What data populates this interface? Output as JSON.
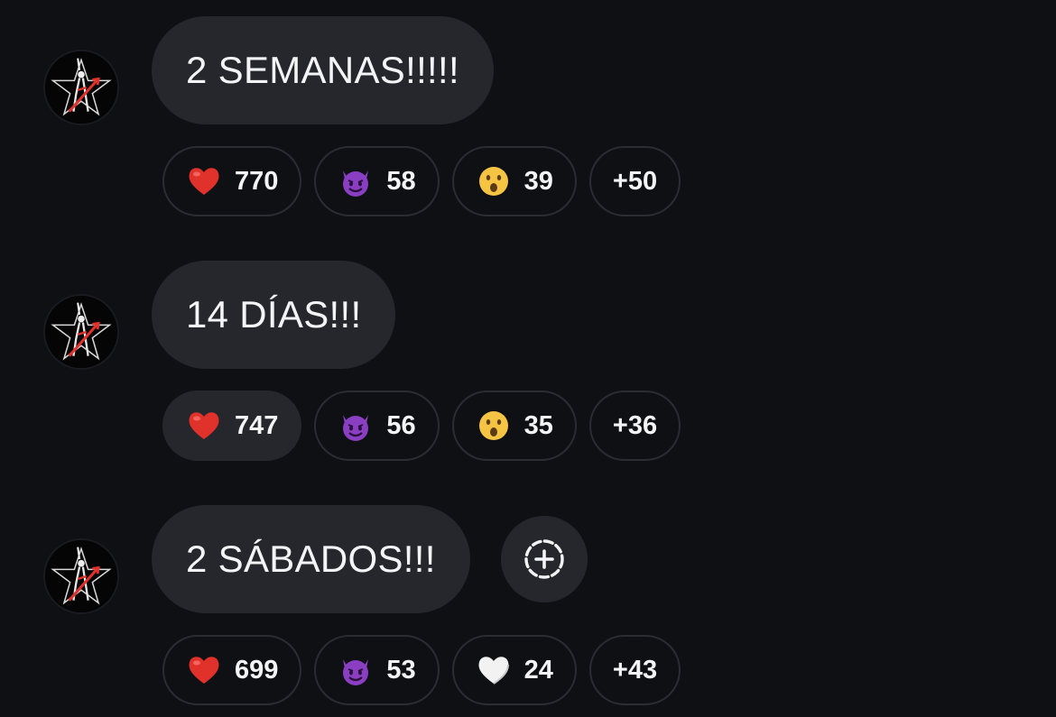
{
  "messages": [
    {
      "text": "2 SEMANAS!!!!!",
      "reactions": [
        {
          "emoji": "red-heart",
          "count": "770",
          "active": false
        },
        {
          "emoji": "smiling-devil",
          "count": "58",
          "active": false
        },
        {
          "emoji": "surprised-face",
          "count": "39",
          "active": false
        }
      ],
      "more": "+50"
    },
    {
      "text": "14 DÍAS!!!",
      "reactions": [
        {
          "emoji": "red-heart",
          "count": "747",
          "active": true
        },
        {
          "emoji": "smiling-devil",
          "count": "56",
          "active": false
        },
        {
          "emoji": "surprised-face",
          "count": "35",
          "active": false
        }
      ],
      "more": "+36"
    },
    {
      "text": "2 SÁBADOS!!!",
      "reactions": [
        {
          "emoji": "red-heart",
          "count": "699",
          "active": false
        },
        {
          "emoji": "smiling-devil",
          "count": "53",
          "active": false
        },
        {
          "emoji": "white-heart",
          "count": "24",
          "active": false
        }
      ],
      "more": "+43"
    }
  ],
  "add_reaction_icon": "add-reaction-icon",
  "colors": {
    "background": "#0f1014",
    "bubble": "#26272c",
    "pill_border": "#2c2d33",
    "text": "#f4f4f6",
    "accent_red": "#e0312b"
  }
}
